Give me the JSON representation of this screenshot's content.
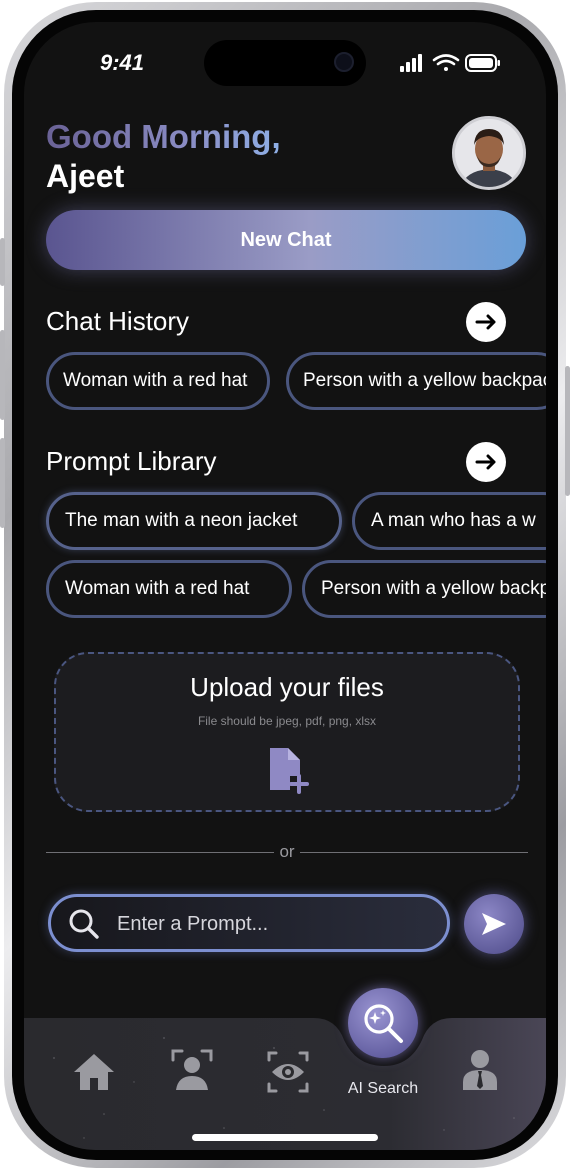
{
  "status_bar": {
    "time": "9:41"
  },
  "header": {
    "greeting": "Good Morning,",
    "username": "Ajeet"
  },
  "new_chat_label": "New Chat",
  "chat_history": {
    "title": "Chat History",
    "chips": [
      "Woman with a red hat",
      "Person with a yellow backpack"
    ]
  },
  "prompt_library": {
    "title": "Prompt Library",
    "row1": [
      "The man with a neon jacket",
      "A man who has a w"
    ],
    "row2": [
      "Woman with a red hat",
      "Person with a yellow backpack"
    ]
  },
  "upload": {
    "title": "Upload your files",
    "subtitle": "File should be jpeg, pdf, png, xlsx",
    "icon": "file-add-icon"
  },
  "divider_text": "or",
  "prompt": {
    "placeholder": "Enter a Prompt...",
    "search_icon": "search-icon",
    "send_icon": "send-icon"
  },
  "bottom_nav": {
    "items": [
      {
        "icon": "home-icon"
      },
      {
        "icon": "face-scan-icon"
      },
      {
        "icon": "eye-icon"
      },
      {
        "icon": "ai-search-icon",
        "label": "AI Search",
        "active": true
      },
      {
        "icon": "profile-icon"
      }
    ]
  },
  "colors": {
    "screen_bg": "#121212",
    "accent_purple": "#5a5590",
    "accent_blue": "#6a9fd8",
    "chip_border": "#4a567e"
  }
}
